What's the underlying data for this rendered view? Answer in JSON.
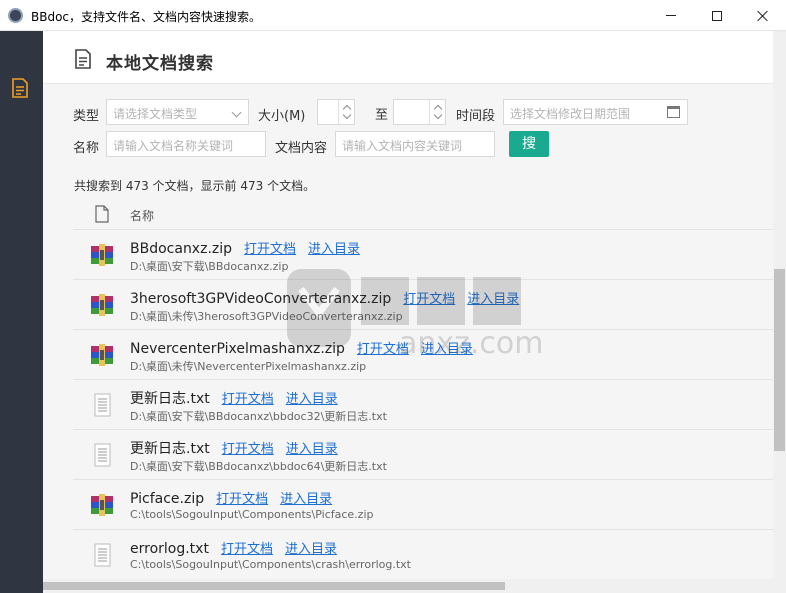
{
  "window": {
    "title": "BBdoc，支持文件名、文档内容快速搜索。",
    "controls": {
      "minimize": "minimize-icon",
      "maximize": "maximize-icon",
      "close": "close-icon"
    }
  },
  "sidebar": {
    "items": [
      {
        "icon": "document-icon",
        "active": true
      }
    ]
  },
  "header": {
    "icon": "document-icon",
    "title": "本地文档搜索"
  },
  "filters": {
    "type_label": "类型",
    "type_placeholder": "请选择文档类型",
    "size_label": "大小(M)",
    "size_from_value": "",
    "size_sep": "至",
    "size_to_value": "",
    "time_label": "时间段",
    "time_placeholder": "选择文档修改日期范围",
    "name_label": "名称",
    "name_placeholder": "请输入文档名称关键词",
    "content_label": "文档内容",
    "content_placeholder": "请输入文档内容关键词",
    "search_button": "搜"
  },
  "summary": "共搜索到 473 个文档，显示前 473 个文档。",
  "table": {
    "name_header": "名称",
    "open_label": "打开文档",
    "dir_label": "进入目录",
    "rows": [
      {
        "icon": "winrar-archive-icon",
        "name": "BBdocanxz.zip",
        "path": "D:\\桌面\\安下载\\BBdocanxz.zip"
      },
      {
        "icon": "winrar-archive-icon",
        "name": "3herosoft3GPVideoConverteranxz.zip",
        "path": "D:\\桌面\\未传\\3herosoft3GPVideoConverteranxz.zip"
      },
      {
        "icon": "winrar-archive-icon",
        "name": "NevercenterPixelmashanxz.zip",
        "path": "D:\\桌面\\未传\\NevercenterPixelmashanxz.zip"
      },
      {
        "icon": "text-file-icon",
        "name": "更新日志.txt",
        "path": "D:\\桌面\\安下载\\BBdocanxz\\bbdoc32\\更新日志.txt"
      },
      {
        "icon": "text-file-icon",
        "name": "更新日志.txt",
        "path": "D:\\桌面\\安下载\\BBdocanxz\\bbdoc64\\更新日志.txt"
      },
      {
        "icon": "winrar-archive-icon",
        "name": "Picface.zip",
        "path": "C:\\tools\\SogouInput\\Components\\Picface.zip"
      },
      {
        "icon": "text-file-icon",
        "name": "errorlog.txt",
        "path": "C:\\tools\\SogouInput\\Components\\crash\\errorlog.txt"
      }
    ]
  },
  "watermark": {
    "text": "anxz.com"
  },
  "colors": {
    "sidebar": "#2f3541",
    "accent": "#1aaa8f",
    "link": "#1f6fd1",
    "sidebar_icon": "#f0a028"
  }
}
